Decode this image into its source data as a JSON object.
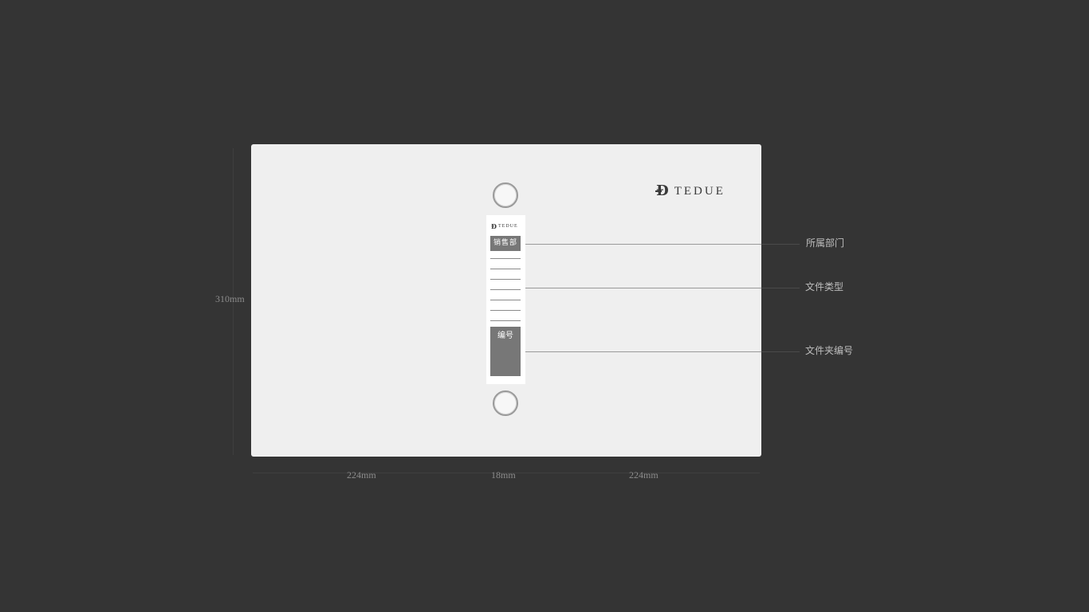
{
  "brand": {
    "mark": "Đ",
    "name": "TEDUE"
  },
  "spine": {
    "department_label": "销售部",
    "number_label": "编号"
  },
  "callouts": {
    "department": "所属部门",
    "file_type": "文件类型",
    "folder_number": "文件夹编号"
  },
  "dimensions": {
    "height": "310mm",
    "left_width": "224mm",
    "spine_width": "18mm",
    "right_width": "224mm"
  },
  "colors": {
    "background": "#343434",
    "board": "#efefef",
    "spine_box": "#777777"
  }
}
